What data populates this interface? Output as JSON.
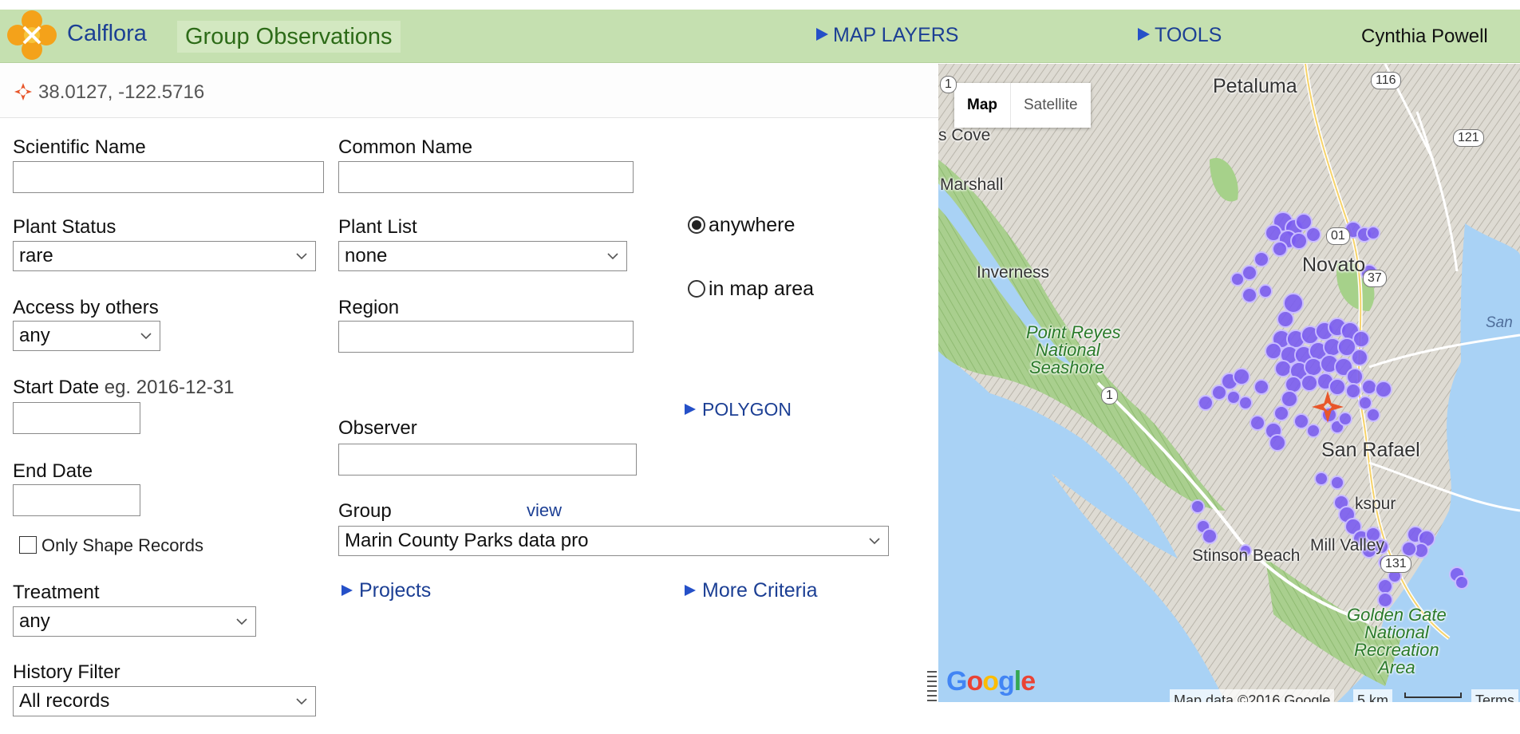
{
  "app": {
    "brand": "Calflora",
    "page_title": "Group Observations"
  },
  "header": {
    "map_layers": "MAP LAYERS",
    "tools": "TOOLS",
    "user": "Cynthia Powell"
  },
  "location": {
    "coords": "38.0127, -122.5716"
  },
  "form": {
    "scientific_name": {
      "label": "Scientific Name",
      "value": ""
    },
    "common_name": {
      "label": "Common Name",
      "value": ""
    },
    "plant_status": {
      "label": "Plant Status",
      "value": "rare"
    },
    "plant_list": {
      "label": "Plant List",
      "value": "none"
    },
    "access": {
      "label": "Access by others",
      "value": "any"
    },
    "region": {
      "label": "Region",
      "value": ""
    },
    "start_date": {
      "label": "Start Date",
      "hint": " eg. 2016-12-31",
      "value": ""
    },
    "observer": {
      "label": "Observer",
      "value": ""
    },
    "end_date": {
      "label": "End Date",
      "value": ""
    },
    "group": {
      "label": "Group",
      "view": "view",
      "value": "Marin County Parks data pro"
    },
    "only_shape": {
      "label": "Only Shape Records",
      "checked": false
    },
    "treatment": {
      "label": "Treatment",
      "value": "any"
    },
    "history": {
      "label": "History Filter",
      "value": "All records"
    },
    "area": {
      "anywhere": "anywhere",
      "in_map": "in map area",
      "selected": "anywhere"
    },
    "polygon": "POLYGON",
    "projects": "Projects",
    "more_criteria": "More Criteria"
  },
  "map": {
    "type_map": "Map",
    "type_satellite": "Satellite",
    "places": {
      "petaluma": "Petaluma",
      "cove": "s Cove",
      "marshall": "Marshall",
      "inverness": "Inverness",
      "novato": "Novato",
      "point_reyes": [
        "Point Reyes",
        "National",
        "Seashore"
      ],
      "san_rafael": "San Rafael",
      "kspur": "kspur",
      "stinson": "Stinson Beach",
      "mill_valley": "Mill Valley",
      "golden_gate": [
        "Golden Gate",
        "National",
        "Recreation",
        "Area"
      ],
      "san": "San"
    },
    "routes": {
      "r116": "116",
      "r121": "121",
      "r101": "01",
      "r37": "37",
      "r1": "1",
      "r1b": "1",
      "r131": "131"
    },
    "attribution": "Map data ©2016 Google",
    "scale": "5 km",
    "terms": "Terms",
    "google": "Google",
    "colors": {
      "point": "#7a5cf0",
      "water": "#a9d2f5",
      "park": "#a6d18a"
    }
  }
}
